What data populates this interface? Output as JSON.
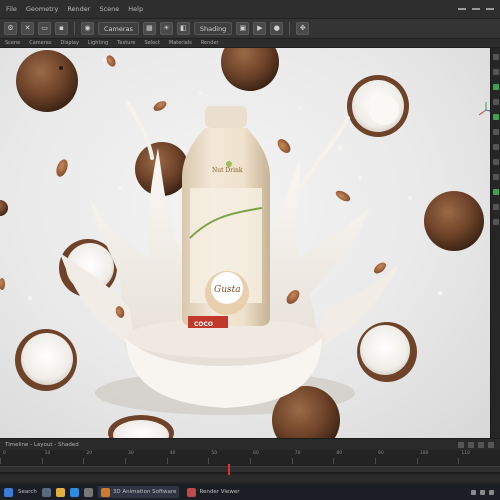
{
  "menubar": {
    "items": [
      "File",
      "Geometry",
      "Render",
      "Scene",
      "Help"
    ]
  },
  "toolbar": {
    "dropdown_1": "Cameras",
    "dropdown_2": "Shading"
  },
  "subbar": {
    "items": [
      "Scene",
      "Cameras",
      "Display",
      "Lighting",
      "Texture",
      "Select",
      "Materials",
      "Render"
    ]
  },
  "viewport": {
    "bottle_brand_top": "Nut Drink",
    "bottle_brand_main": "Gusta",
    "bottle_label_bottom": "COCO",
    "background_color": "#ececec",
    "milk_color": "#f7f3ee",
    "coconut_shell_color": "#7a4a2e",
    "bottle_color": "#e9dcc8"
  },
  "timeline": {
    "header_left": "Timeline - Layout - Shaded",
    "ruler_labels": [
      "0",
      "10",
      "20",
      "30",
      "40",
      "50",
      "60",
      "70",
      "80",
      "90",
      "100",
      "110"
    ]
  },
  "taskbar": {
    "search_label": "Search",
    "app_1": "3D Animation Software",
    "app_2": "Render Viewer"
  }
}
